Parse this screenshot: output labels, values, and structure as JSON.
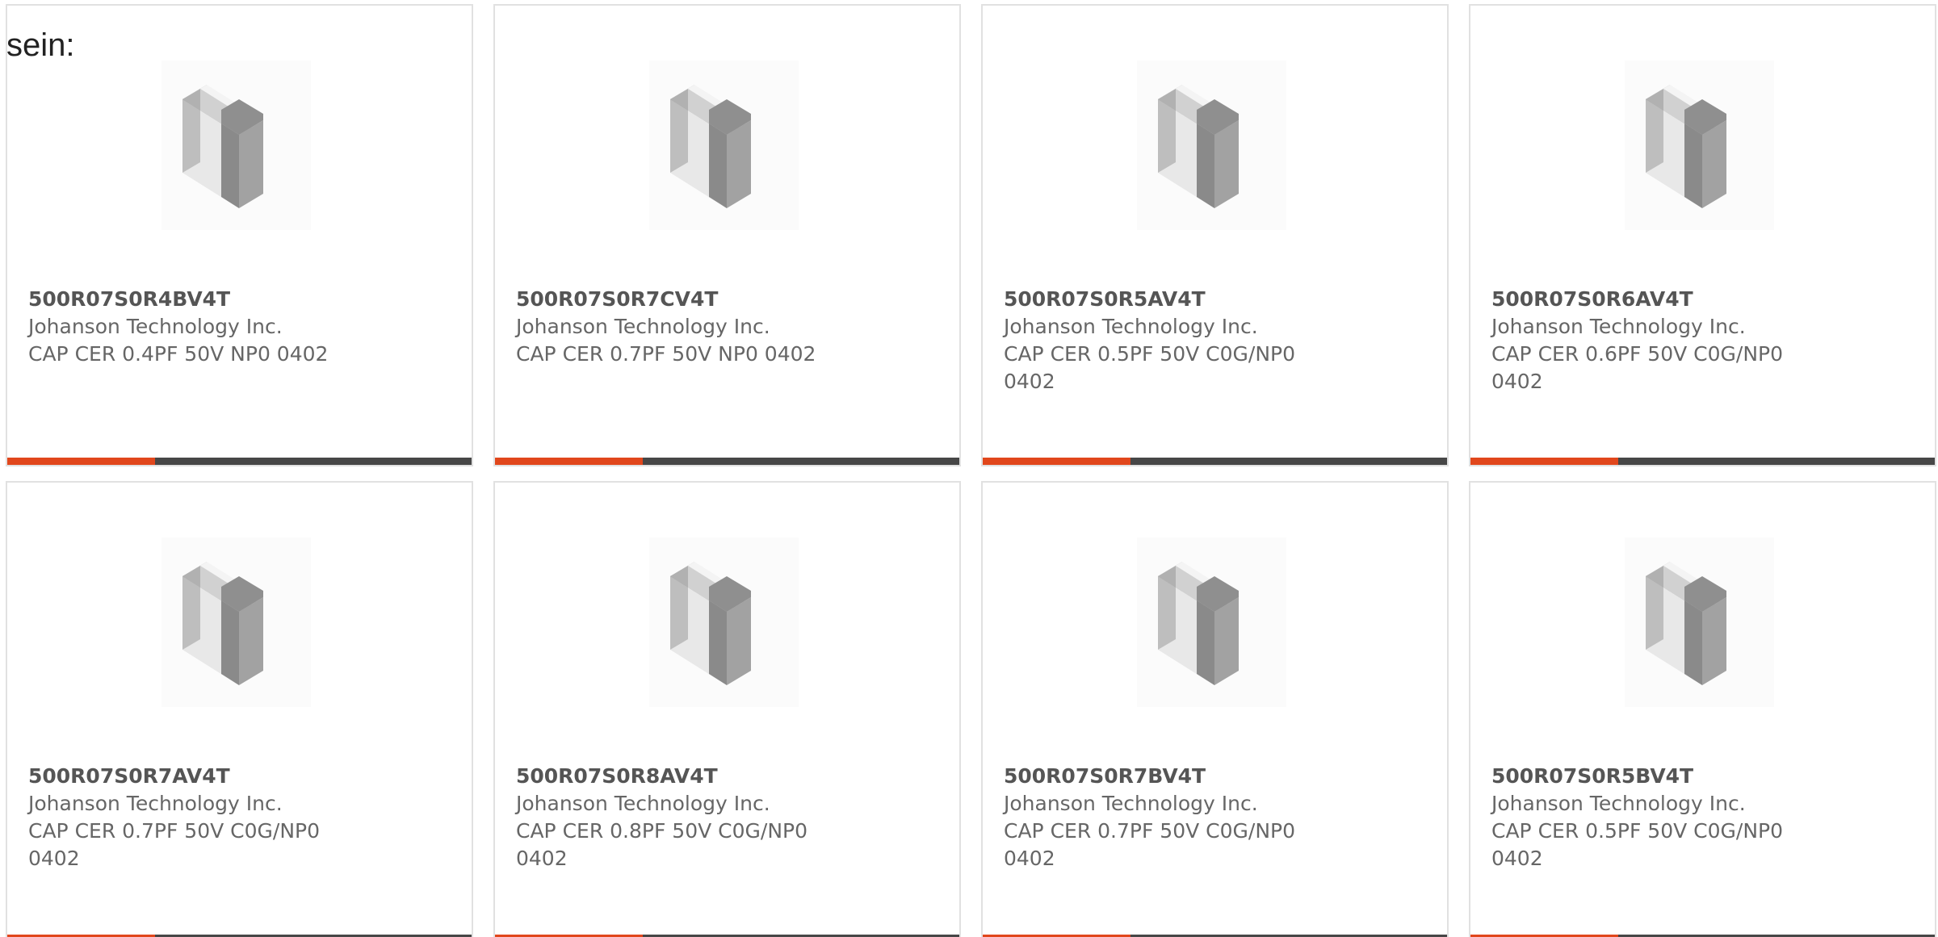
{
  "intro": {
    "text": "sein:"
  },
  "colors": {
    "accent": "#e1471c",
    "bar": "#474747",
    "border": "#e1e1e1",
    "text": "#666666"
  },
  "cards": [
    {
      "part_number": "500R07S0R4BV4T",
      "manufacturer": "Johanson Technology Inc.",
      "description": "CAP CER 0.4PF 50V NP0 0402",
      "image_icon": "capacitor-chip-icon"
    },
    {
      "part_number": "500R07S0R7CV4T",
      "manufacturer": "Johanson Technology Inc.",
      "description": "CAP CER 0.7PF 50V NP0 0402",
      "image_icon": "capacitor-chip-icon"
    },
    {
      "part_number": "500R07S0R5AV4T",
      "manufacturer": "Johanson Technology Inc.",
      "description": "CAP CER 0.5PF 50V C0G/NP0 0402",
      "image_icon": "capacitor-chip-icon"
    },
    {
      "part_number": "500R07S0R6AV4T",
      "manufacturer": "Johanson Technology Inc.",
      "description": "CAP CER 0.6PF 50V C0G/NP0 0402",
      "image_icon": "capacitor-chip-icon"
    },
    {
      "part_number": "500R07S0R7AV4T",
      "manufacturer": "Johanson Technology Inc.",
      "description": "CAP CER 0.7PF 50V C0G/NP0 0402",
      "image_icon": "capacitor-chip-icon"
    },
    {
      "part_number": "500R07S0R8AV4T",
      "manufacturer": "Johanson Technology Inc.",
      "description": "CAP CER 0.8PF 50V C0G/NP0 0402",
      "image_icon": "capacitor-chip-icon"
    },
    {
      "part_number": "500R07S0R7BV4T",
      "manufacturer": "Johanson Technology Inc.",
      "description": "CAP CER 0.7PF 50V C0G/NP0 0402",
      "image_icon": "capacitor-chip-icon"
    },
    {
      "part_number": "500R07S0R5BV4T",
      "manufacturer": "Johanson Technology Inc.",
      "description": "CAP CER 0.5PF 50V C0G/NP0 0402",
      "image_icon": "capacitor-chip-icon"
    }
  ]
}
